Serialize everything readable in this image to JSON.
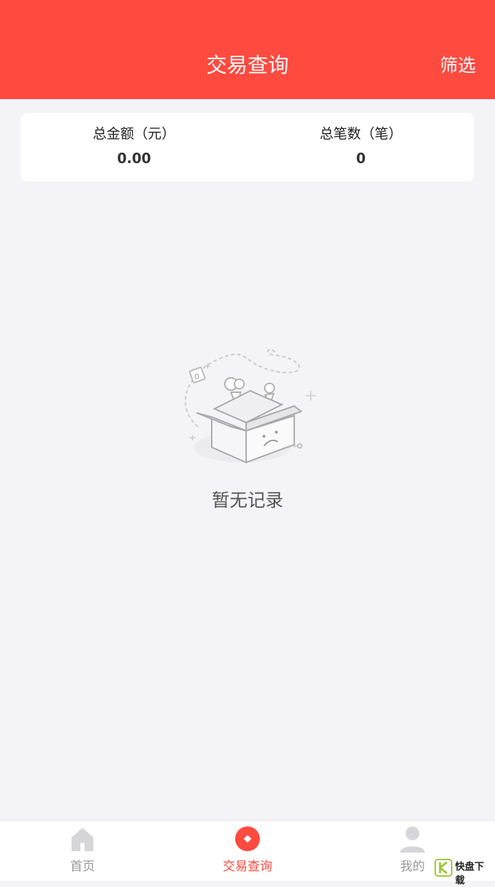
{
  "header": {
    "title": "交易查询",
    "filter_label": "筛选"
  },
  "summary": {
    "total_amount_label": "总金额（元）",
    "total_amount_value": "0.00",
    "total_count_label": "总笔数（笔）",
    "total_count_value": "0"
  },
  "empty_state": {
    "icon": "empty-box-icon",
    "text": "暂无记录"
  },
  "tabbar": {
    "items": [
      {
        "label": "首页",
        "icon": "home-icon"
      },
      {
        "label": "交易查询",
        "icon": "trade-query-icon",
        "active": true
      },
      {
        "label": "我的",
        "icon": "user-icon"
      }
    ]
  },
  "watermark": {
    "text": "快盘下载"
  },
  "colors": {
    "primary": "#ff4a40",
    "background": "#f4f4f8",
    "inactive": "#9a9a9a"
  }
}
